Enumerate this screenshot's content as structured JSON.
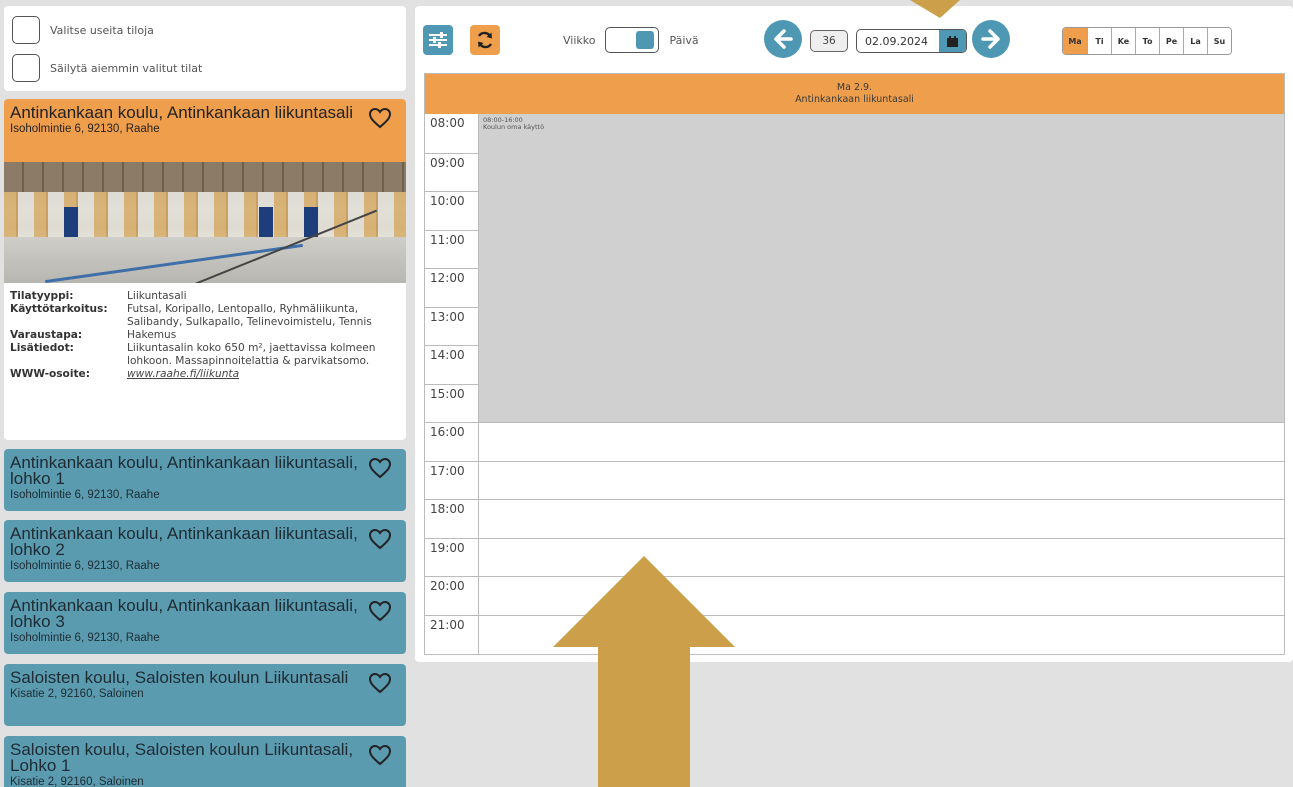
{
  "options": {
    "multi_select": "Valitse useita tiloja",
    "keep_selected": "Säilytä aiemmin valitut tilat"
  },
  "selected_venue": {
    "title": "Antinkankaan koulu, Antinkankaan liikuntasali",
    "address": "Isoholmintie 6, 92130, Raahe",
    "details": {
      "type_label": "Tilatyyppi:",
      "type_value": "Liikuntasali",
      "purpose_label": "Käyttötarkoitus:",
      "purpose_value": "Futsal, Koripallo, Lentopallo, Ryhmäliikunta, Salibandy, Sulkapallo, Telinevoimistelu, Tennis",
      "booking_label": "Varaustapa:",
      "booking_value": "Hakemus",
      "extra_label": "Lisätiedot:",
      "extra_value": "Liikuntasalin koko 650 m², jaettavissa kolmeen lohkoon. Massapinnoitelattia & parvikatsomo.",
      "www_label": "WWW-osoite:",
      "www_value": "www.raahe.fi/liikunta"
    }
  },
  "venues": [
    {
      "title": "Antinkankaan koulu, Antinkankaan liikuntasali, lohko 1",
      "address": "Isoholmintie 6, 92130, Raahe"
    },
    {
      "title": "Antinkankaan koulu, Antinkankaan liikuntasali, lohko 2",
      "address": "Isoholmintie 6, 92130, Raahe"
    },
    {
      "title": "Antinkankaan koulu, Antinkankaan liikuntasali, lohko 3",
      "address": "Isoholmintie 6, 92130, Raahe"
    },
    {
      "title": "Saloisten koulu, Saloisten koulun Liikuntasali",
      "address": "Kisatie 2, 92160, Saloinen"
    },
    {
      "title": "Saloisten koulu, Saloisten koulun Liikuntasali, Lohko 1",
      "address": "Kisatie 2, 92160, Saloinen"
    }
  ],
  "toolbar": {
    "week_label": "Viikko",
    "day_label": "Päivä",
    "week_number": "36",
    "date": "02.09.2024",
    "days": [
      "Ma",
      "Ti",
      "Ke",
      "To",
      "Pe",
      "La",
      "Su"
    ],
    "active_day": "Ma"
  },
  "calendar": {
    "header_day": "Ma 2.9.",
    "header_venue": "Antinkankaan liikuntasali",
    "hours": [
      "08:00",
      "09:00",
      "10:00",
      "11:00",
      "12:00",
      "13:00",
      "14:00",
      "15:00",
      "16:00",
      "17:00",
      "18:00",
      "19:00",
      "20:00",
      "21:00"
    ],
    "booking": {
      "time": "08:00-16:00",
      "label": "Koulun oma käyttö"
    }
  },
  "colors": {
    "orange": "#ef9f4c",
    "teal": "#5b9bb0",
    "blue": "#4e98b4",
    "booked": "#d0d0d0",
    "arrow": "#cc9f4a"
  }
}
